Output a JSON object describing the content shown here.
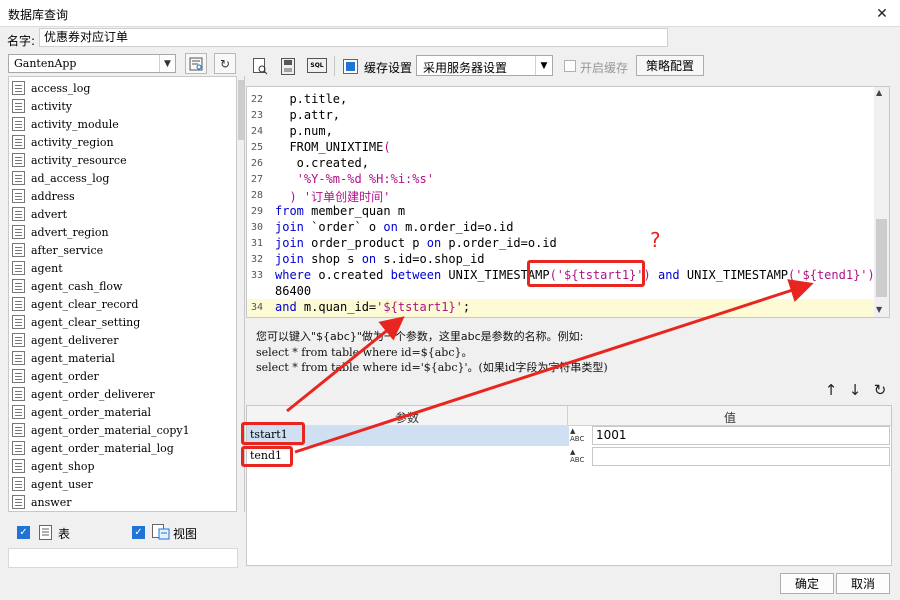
{
  "window": {
    "title": "数据库查询",
    "close_glyph": "✕"
  },
  "name_field": {
    "label": "名字:",
    "value": "优惠券对应订单"
  },
  "left_panel": {
    "app_select": "GantenApp",
    "tables": [
      "access_log",
      "activity",
      "activity_module",
      "activity_region",
      "activity_resource",
      "ad_access_log",
      "address",
      "advert",
      "advert_region",
      "after_service",
      "agent",
      "agent_cash_flow",
      "agent_clear_record",
      "agent_clear_setting",
      "agent_deliverer",
      "agent_material",
      "agent_order",
      "agent_order_deliverer",
      "agent_order_material",
      "agent_order_material_copy1",
      "agent_order_material_log",
      "agent_shop",
      "agent_user",
      "answer"
    ],
    "show_tables_label": "表",
    "show_views_label": "视图"
  },
  "right_toolbar": {
    "sql_icon_text": "SQL",
    "cache_settings_label": "缓存设置",
    "cache_select_value": "采用服务器设置",
    "enable_cache_label": "开启缓存",
    "strategy_button": "策略配置"
  },
  "editor": {
    "lines": [
      {
        "n": "22",
        "code": "  p.title,"
      },
      {
        "n": "23",
        "code": "  p.attr,"
      },
      {
        "n": "24",
        "code": "  p.num,"
      },
      {
        "n": "25",
        "code": "  FROM_UNIXTIME("
      },
      {
        "n": "26",
        "code": "   o.created,"
      },
      {
        "n": "27",
        "code": "   '%Y-%m-%d %H:%i:%s'"
      },
      {
        "n": "28",
        "code": "  ) '订单创建时间'"
      },
      {
        "n": "29",
        "code": "from member_quan m"
      },
      {
        "n": "30",
        "code": "join `order` o on m.order_id=o.id"
      },
      {
        "n": "31",
        "code": "join order_product p on p.order_id=o.id"
      },
      {
        "n": "32",
        "code": "join shop s on s.id=o.shop_id"
      },
      {
        "n": "33",
        "code": "where o.created between UNIX_TIMESTAMP('${tstart1}') and UNIX_TIMESTAMP('${tend1}')+"
      },
      {
        "n": "",
        "code": "86400"
      },
      {
        "n": "34",
        "code": "and m.quan_id='${tstart1}';"
      }
    ]
  },
  "hint": {
    "line1": "您可以键入\"${abc}\"做为一个参数，这里abc是参数的名称。例如:",
    "line2": "select * from table where id=${abc}。",
    "line3": "select * from table where id='${abc}'。(如果id字段为字符串类型)"
  },
  "params": {
    "header_name": "参数",
    "header_value": "值",
    "rows": [
      {
        "name": "tstart1",
        "type": "ABC",
        "value": "1001"
      },
      {
        "name": "tend1",
        "type": "ABC",
        "value": ""
      }
    ]
  },
  "annotation": {
    "question_mark": "?"
  },
  "dialog_buttons": {
    "ok": "确定",
    "cancel": "取消"
  },
  "colors": {
    "annotation_red": "#e8261f",
    "keyword_blue": "#0000d0",
    "string_magenta": "#b0128c",
    "highlight_line": "#fdfbd6",
    "checkbox_blue": "#1f74d6"
  }
}
